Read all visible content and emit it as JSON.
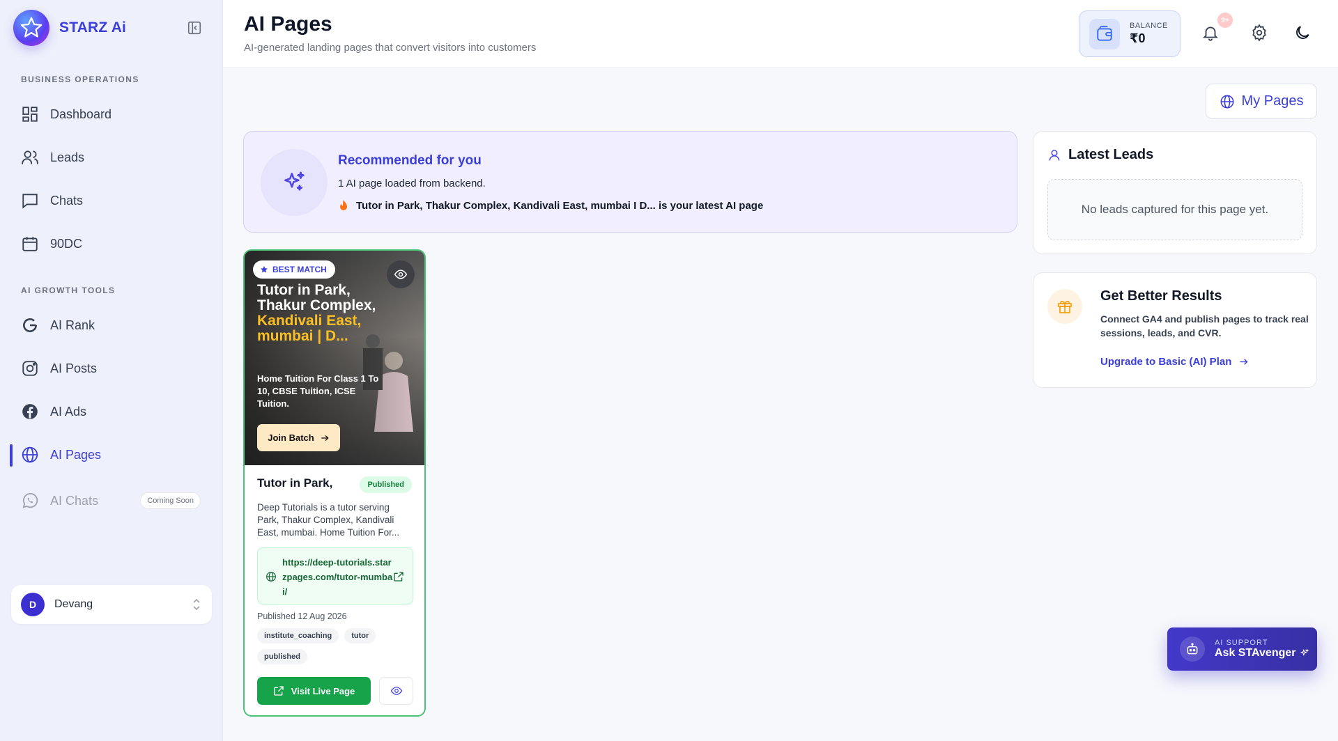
{
  "brand": {
    "name": "STARZ Ai"
  },
  "sidebar": {
    "section_business": "BUSINESS OPERATIONS",
    "section_growth": "AI GROWTH TOOLS",
    "items": [
      {
        "label": "Dashboard",
        "icon": "grid-icon"
      },
      {
        "label": "Leads",
        "icon": "users-icon"
      },
      {
        "label": "Chats",
        "icon": "chat-icon"
      },
      {
        "label": "90DC",
        "icon": "calendar-icon"
      },
      {
        "label": "AI Rank",
        "icon": "google-icon"
      },
      {
        "label": "AI Posts",
        "icon": "instagram-icon"
      },
      {
        "label": "AI Ads",
        "icon": "facebook-icon"
      },
      {
        "label": "AI Pages",
        "icon": "globe-icon"
      },
      {
        "label": "AI Chats",
        "icon": "whatsapp-icon",
        "badge": "Coming Soon"
      }
    ],
    "user": {
      "initial": "D",
      "name": "Devang"
    }
  },
  "header": {
    "title": "AI Pages",
    "subtitle": "AI-generated landing pages that convert visitors into customers",
    "balance_label": "BALANCE",
    "balance_value": "₹0",
    "notif_count": "9+"
  },
  "my_pages_label": "My Pages",
  "recommendation": {
    "title": "Recommended for you",
    "line1": "1 AI page loaded from backend.",
    "line2": "Tutor in Park, Thakur Complex, Kandivali East, mumbai I D... is your latest AI page"
  },
  "page_card": {
    "best_match": "BEST MATCH",
    "hero_title_white": "Tutor in Park, Thakur Complex,",
    "hero_title_yellow": "Kandivali East, mumbai | D...",
    "hero_desc": "Home Tuition For Class 1 To 10, CBSE Tuition, ICSE Tuition.",
    "join_label": "Join Batch",
    "title": "Tutor in Park,",
    "status": "Published",
    "description": "Deep Tutorials is a tutor serving Park, Thakur Complex, Kandivali East, mumbai. Home Tuition For...",
    "url": "https://deep-tutorials.starzpages.com/tutor-mumbai/",
    "published_date": "Published 12 Aug 2026",
    "tags": [
      "institute_coaching",
      "tutor",
      "published"
    ],
    "visit_label": "Visit Live Page"
  },
  "latest_leads": {
    "title": "Latest Leads",
    "empty": "No leads captured for this page yet."
  },
  "better_results": {
    "title": "Get Better Results",
    "desc": "Connect GA4 and publish pages to track real sessions, leads, and CVR.",
    "link": "Upgrade to Basic (AI) Plan"
  },
  "support": {
    "label": "AI SUPPORT",
    "name": "Ask STAvenger"
  },
  "colors": {
    "accent": "#3b3fd8",
    "success": "#16a34a",
    "sidebar_bg": "#eef0fb"
  }
}
